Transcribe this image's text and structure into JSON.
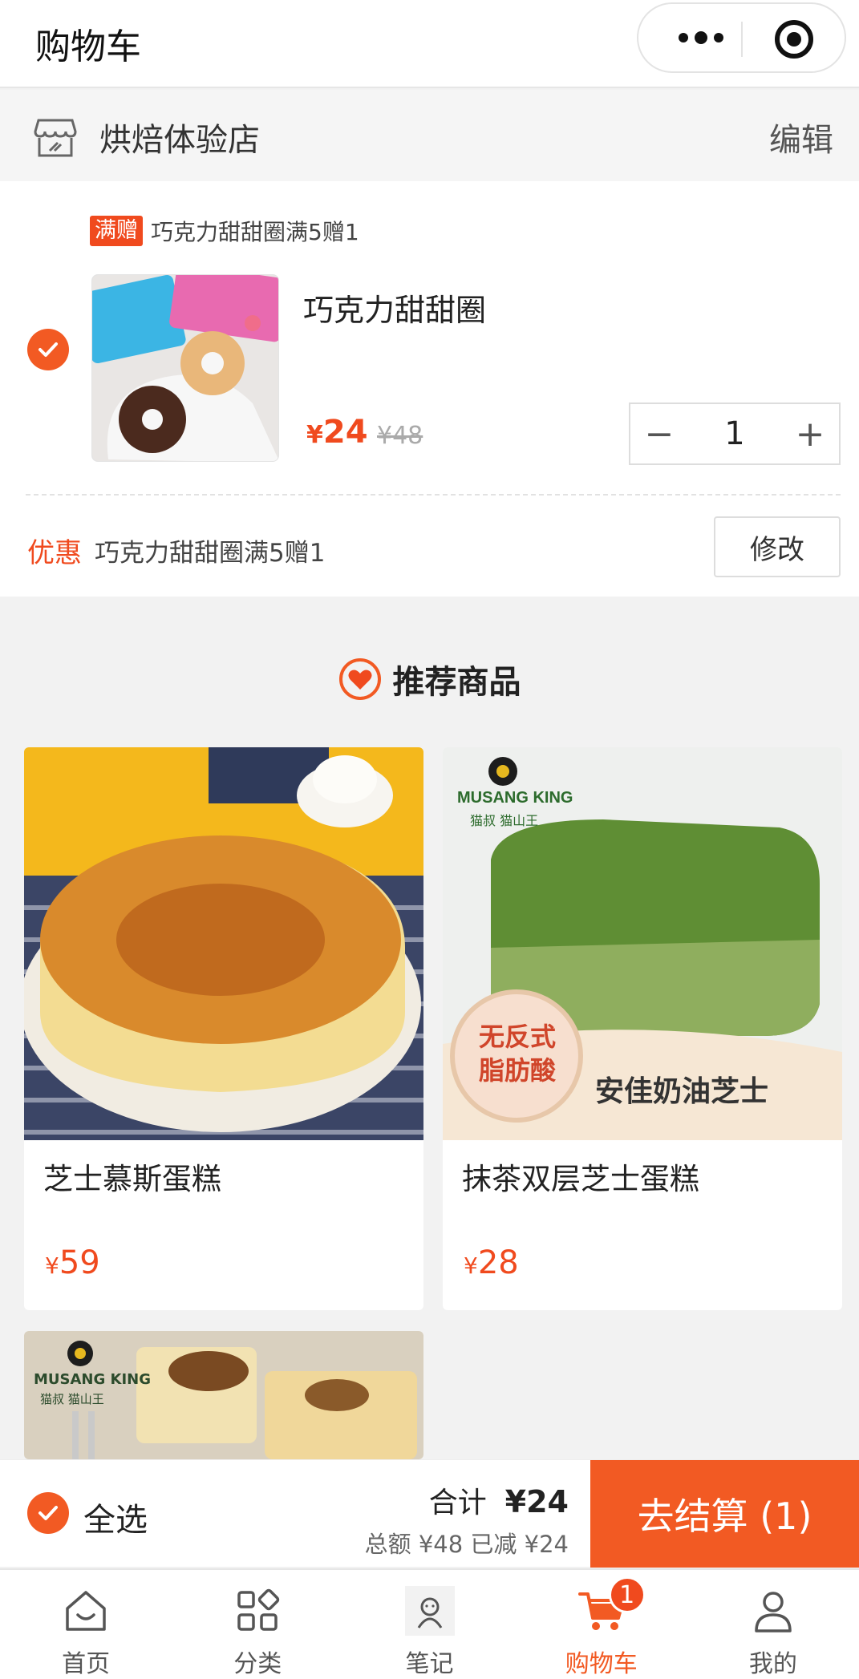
{
  "header": {
    "title": "购物车"
  },
  "shop": {
    "name": "烘焙体验店",
    "edit_label": "编辑"
  },
  "cart_item": {
    "promo_tag": "满赠",
    "promo_text": "巧克力甜甜圈满5赠1",
    "name": "巧克力甜甜圈",
    "currency": "¥",
    "price": "24",
    "original_price": "¥48",
    "quantity": "1",
    "minus_label": "−",
    "plus_label": "+",
    "selected": true
  },
  "discount": {
    "label": "优惠",
    "text": "巧克力甜甜圈满5赠1",
    "modify_label": "修改"
  },
  "recommend": {
    "title": "推荐商品",
    "products": [
      {
        "name": "芝士慕斯蛋糕",
        "currency": "¥",
        "price": "59"
      },
      {
        "name": "抹茶双层芝士蛋糕",
        "currency": "¥",
        "price": "28",
        "img_brand": "MUSANG KING",
        "img_brand_cn": "猫叔 猫山王",
        "img_badge": "无反式\n脂肪酸",
        "img_caption": "安佳奶油芝士"
      },
      {
        "img_brand": "MUSANG KING",
        "img_brand_cn": "猫叔 猫山王"
      }
    ]
  },
  "checkout": {
    "select_all_label": "全选",
    "total_label": "合计",
    "total_value": "¥24",
    "sub_label": "总额 ¥48 已减 ¥24",
    "pay_label": "去结算 (1)"
  },
  "tabbar": {
    "tabs": [
      {
        "label": "首页",
        "icon": "home-icon"
      },
      {
        "label": "分类",
        "icon": "category-icon"
      },
      {
        "label": "笔记",
        "icon": "notes-icon"
      },
      {
        "label": "购物车",
        "icon": "cart-icon",
        "badge": "1",
        "active": true
      },
      {
        "label": "我的",
        "icon": "user-icon"
      }
    ]
  },
  "colors": {
    "accent": "#f25a23",
    "price": "#f04a1e",
    "background": "#f2f2f2"
  }
}
